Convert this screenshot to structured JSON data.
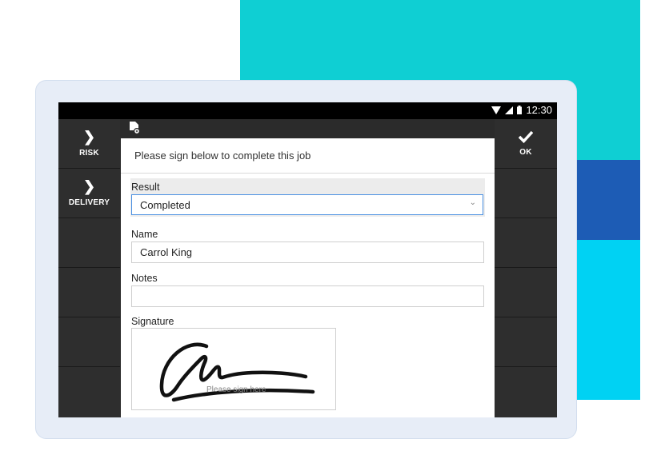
{
  "status_bar": {
    "time": "12:30"
  },
  "left_nav": [
    {
      "label": "RISK",
      "icon": "chevron-right-icon"
    },
    {
      "label": "DELIVERY",
      "icon": "chevron-right-icon"
    }
  ],
  "right_nav": {
    "ok_label": "OK",
    "icon": "check-icon"
  },
  "dialog": {
    "title": "Please sign below to complete this job",
    "result": {
      "label": "Result",
      "value": "Completed"
    },
    "name": {
      "label": "Name",
      "value": "Carrol King"
    },
    "notes": {
      "label": "Notes",
      "value": ""
    },
    "signature": {
      "label": "Signature",
      "placeholder": "Please sign here"
    }
  },
  "colors": {
    "teal": "#0fcfd3",
    "blue": "#1d5cb5",
    "cyan": "#00d2f3",
    "focus_border": "#4a90e2",
    "nav_bg": "#2e2e2e"
  }
}
